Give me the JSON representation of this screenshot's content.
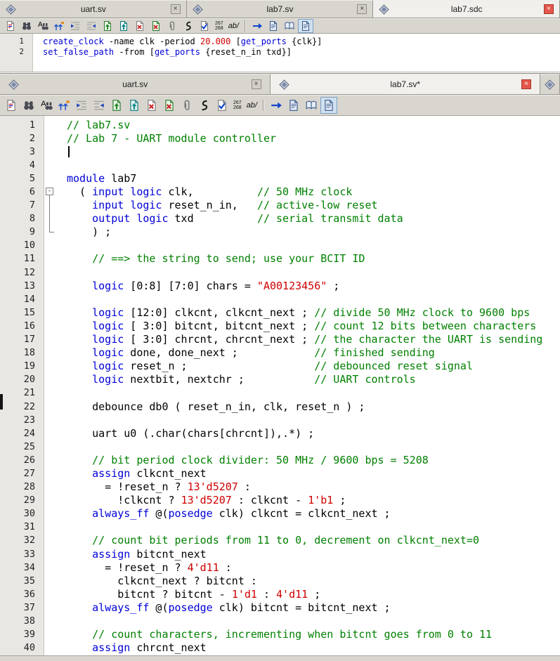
{
  "colors": {
    "keyword": "#0000d8",
    "comment": "#008000",
    "literal": "#cf0000",
    "plain": "#000000",
    "active_close": "#e4564a"
  },
  "toolbar_icons": [
    {
      "name": "edit-document-icon",
      "sprite": "docedit"
    },
    {
      "name": "find-icon",
      "sprite": "binoc"
    },
    {
      "name": "find-replace-icon",
      "sprite": "binoca"
    },
    {
      "name": "goto-bookmark-icon",
      "sprite": "goto"
    },
    {
      "name": "indent-icon",
      "sprite": "indent"
    },
    {
      "name": "outdent-icon",
      "sprite": "outdent"
    },
    {
      "name": "insert-page-icon",
      "sprite": "pageup"
    },
    {
      "name": "export-page-icon",
      "sprite": "pageup2"
    },
    {
      "name": "delete-page-icon",
      "sprite": "pagex"
    },
    {
      "name": "remove-page-icon",
      "sprite": "pagex2"
    },
    {
      "name": "attachment-icon",
      "sprite": "clip"
    },
    {
      "name": "macro-icon",
      "sprite": "squiggle"
    },
    {
      "name": "syntax-check-icon",
      "sprite": "pagecheck"
    },
    {
      "name": "line-count-badge",
      "text": [
        "267",
        "268"
      ]
    },
    {
      "name": "word-wrap-badge",
      "text": [
        "ab/"
      ]
    },
    {
      "name": "toolbar-separator",
      "sep": true
    },
    {
      "name": "next-bookmark-icon",
      "sprite": "arrowblue"
    },
    {
      "name": "template-page-icon",
      "sprite": "pageblue"
    },
    {
      "name": "open-book-icon",
      "sprite": "book"
    },
    {
      "name": "notes-page-icon",
      "sprite": "pageblue",
      "pressed": true
    }
  ],
  "top_window": {
    "tabs": [
      {
        "label": "uart.sv",
        "active": false
      },
      {
        "label": "lab7.sv",
        "active": false
      },
      {
        "label": "lab7.sdc",
        "active": true
      }
    ],
    "code": [
      {
        "n": 1,
        "seg": [
          [
            "k",
            "create_clock"
          ],
          [
            "p",
            " -name clk -period "
          ],
          [
            "n",
            "20.000"
          ],
          [
            "p",
            " ["
          ],
          [
            "k",
            "get_ports"
          ],
          [
            "p",
            " {clk}]"
          ]
        ]
      },
      {
        "n": 2,
        "seg": [
          [
            "k",
            "set_false_path"
          ],
          [
            "p",
            " -from ["
          ],
          [
            "k",
            "get_ports"
          ],
          [
            "p",
            " {reset_n_in txd}]"
          ]
        ]
      }
    ]
  },
  "bottom_window": {
    "tabs": [
      {
        "label": "uart.sv",
        "active": false
      },
      {
        "label": "lab7.sv*",
        "active": true
      },
      {
        "label": "",
        "partial": true
      }
    ],
    "code": [
      {
        "n": 1,
        "seg": [
          [
            "c",
            "// lab7.sv"
          ]
        ]
      },
      {
        "n": 2,
        "seg": [
          [
            "c",
            "// Lab 7 - UART module controller"
          ]
        ]
      },
      {
        "n": 3,
        "caret": true,
        "seg": []
      },
      {
        "n": 4,
        "seg": []
      },
      {
        "n": 5,
        "seg": [
          [
            "k",
            "module"
          ],
          [
            "p",
            " lab7"
          ]
        ]
      },
      {
        "n": 6,
        "fold": "start",
        "seg": [
          [
            "p",
            "  ( "
          ],
          [
            "k",
            "input"
          ],
          [
            "p",
            " "
          ],
          [
            "k",
            "logic"
          ],
          [
            "p",
            " clk,          "
          ],
          [
            "c",
            "// 50 MHz clock"
          ]
        ]
      },
      {
        "n": 7,
        "fold": "mid",
        "seg": [
          [
            "p",
            "    "
          ],
          [
            "k",
            "input"
          ],
          [
            "p",
            " "
          ],
          [
            "k",
            "logic"
          ],
          [
            "p",
            " reset_n_in,   "
          ],
          [
            "c",
            "// active-low reset"
          ]
        ]
      },
      {
        "n": 8,
        "fold": "mid",
        "seg": [
          [
            "p",
            "    "
          ],
          [
            "k",
            "output"
          ],
          [
            "p",
            " "
          ],
          [
            "k",
            "logic"
          ],
          [
            "p",
            " txd          "
          ],
          [
            "c",
            "// serial transmit data"
          ]
        ]
      },
      {
        "n": 9,
        "fold": "end",
        "seg": [
          [
            "p",
            "    ) ;"
          ]
        ]
      },
      {
        "n": 10,
        "seg": []
      },
      {
        "n": 11,
        "seg": [
          [
            "p",
            "    "
          ],
          [
            "c",
            "// ==> the string to send; use your BCIT ID"
          ]
        ]
      },
      {
        "n": 12,
        "seg": []
      },
      {
        "n": 13,
        "seg": [
          [
            "p",
            "    "
          ],
          [
            "k",
            "logic"
          ],
          [
            "p",
            " [0:8] [7:0] chars = "
          ],
          [
            "s",
            "\"A00123456\""
          ],
          [
            "p",
            " ;"
          ]
        ]
      },
      {
        "n": 14,
        "seg": []
      },
      {
        "n": 15,
        "seg": [
          [
            "p",
            "    "
          ],
          [
            "k",
            "logic"
          ],
          [
            "p",
            " [12:0] clkcnt, clkcnt_next ; "
          ],
          [
            "c",
            "// divide 50 MHz clock to 9600 bps"
          ]
        ]
      },
      {
        "n": 16,
        "seg": [
          [
            "p",
            "    "
          ],
          [
            "k",
            "logic"
          ],
          [
            "p",
            " [ 3:0] bitcnt, bitcnt_next ; "
          ],
          [
            "c",
            "// count 12 bits between characters"
          ]
        ]
      },
      {
        "n": 17,
        "seg": [
          [
            "p",
            "    "
          ],
          [
            "k",
            "logic"
          ],
          [
            "p",
            " [ 3:0] chrcnt, chrcnt_next ; "
          ],
          [
            "c",
            "// the character the UART is sending"
          ]
        ]
      },
      {
        "n": 18,
        "seg": [
          [
            "p",
            "    "
          ],
          [
            "k",
            "logic"
          ],
          [
            "p",
            " done, done_next ;            "
          ],
          [
            "c",
            "// finished sending"
          ]
        ]
      },
      {
        "n": 19,
        "seg": [
          [
            "p",
            "    "
          ],
          [
            "k",
            "logic"
          ],
          [
            "p",
            " reset_n ;                    "
          ],
          [
            "c",
            "// debounced reset signal"
          ]
        ]
      },
      {
        "n": 20,
        "seg": [
          [
            "p",
            "    "
          ],
          [
            "k",
            "logic"
          ],
          [
            "p",
            " nextbit, nextchr ;           "
          ],
          [
            "c",
            "// UART controls"
          ]
        ]
      },
      {
        "n": 21,
        "seg": []
      },
      {
        "n": 22,
        "seg": [
          [
            "p",
            "    debounce db0 ( reset_n_in, clk, reset_n ) ;"
          ]
        ]
      },
      {
        "n": 23,
        "seg": []
      },
      {
        "n": 24,
        "seg": [
          [
            "p",
            "    uart u0 (.char(chars[chrcnt]),.*) ;"
          ]
        ]
      },
      {
        "n": 25,
        "seg": []
      },
      {
        "n": 26,
        "seg": [
          [
            "p",
            "    "
          ],
          [
            "c",
            "// bit period clock divider: 50 MHz / 9600 bps = 5208"
          ]
        ]
      },
      {
        "n": 27,
        "seg": [
          [
            "p",
            "    "
          ],
          [
            "k",
            "assign"
          ],
          [
            "p",
            " clkcnt_next"
          ]
        ]
      },
      {
        "n": 28,
        "seg": [
          [
            "p",
            "      = !reset_n ? "
          ],
          [
            "n",
            "13'd5207"
          ],
          [
            "p",
            " :"
          ]
        ]
      },
      {
        "n": 29,
        "seg": [
          [
            "p",
            "        !clkcnt ? "
          ],
          [
            "n",
            "13'd5207"
          ],
          [
            "p",
            " : clkcnt - "
          ],
          [
            "n",
            "1'b1"
          ],
          [
            "p",
            " ;"
          ]
        ]
      },
      {
        "n": 30,
        "seg": [
          [
            "p",
            "    "
          ],
          [
            "k",
            "always_ff"
          ],
          [
            "p",
            " @("
          ],
          [
            "k",
            "posedge"
          ],
          [
            "p",
            " clk) clkcnt = clkcnt_next ;"
          ]
        ]
      },
      {
        "n": 31,
        "seg": []
      },
      {
        "n": 32,
        "seg": [
          [
            "p",
            "    "
          ],
          [
            "c",
            "// count bit periods from 11 to 0, decrement on clkcnt_next=0"
          ]
        ]
      },
      {
        "n": 33,
        "seg": [
          [
            "p",
            "    "
          ],
          [
            "k",
            "assign"
          ],
          [
            "p",
            " bitcnt_next"
          ]
        ]
      },
      {
        "n": 34,
        "seg": [
          [
            "p",
            "      = !reset_n ? "
          ],
          [
            "n",
            "4'd11"
          ],
          [
            "p",
            " :"
          ]
        ]
      },
      {
        "n": 35,
        "seg": [
          [
            "p",
            "        clkcnt_next ? bitcnt :"
          ]
        ]
      },
      {
        "n": 36,
        "seg": [
          [
            "p",
            "        bitcnt ? bitcnt - "
          ],
          [
            "n",
            "1'd1"
          ],
          [
            "p",
            " : "
          ],
          [
            "n",
            "4'd11"
          ],
          [
            "p",
            " ;"
          ]
        ]
      },
      {
        "n": 37,
        "seg": [
          [
            "p",
            "    "
          ],
          [
            "k",
            "always_ff"
          ],
          [
            "p",
            " @("
          ],
          [
            "k",
            "posedge"
          ],
          [
            "p",
            " clk) bitcnt = bitcnt_next ;"
          ]
        ]
      },
      {
        "n": 38,
        "seg": []
      },
      {
        "n": 39,
        "seg": [
          [
            "p",
            "    "
          ],
          [
            "c",
            "// count characters, incrementing when bitcnt goes from 0 to 11"
          ]
        ]
      },
      {
        "n": 40,
        "seg": [
          [
            "p",
            "    "
          ],
          [
            "k",
            "assign"
          ],
          [
            "p",
            " chrcnt_next"
          ]
        ]
      }
    ]
  }
}
